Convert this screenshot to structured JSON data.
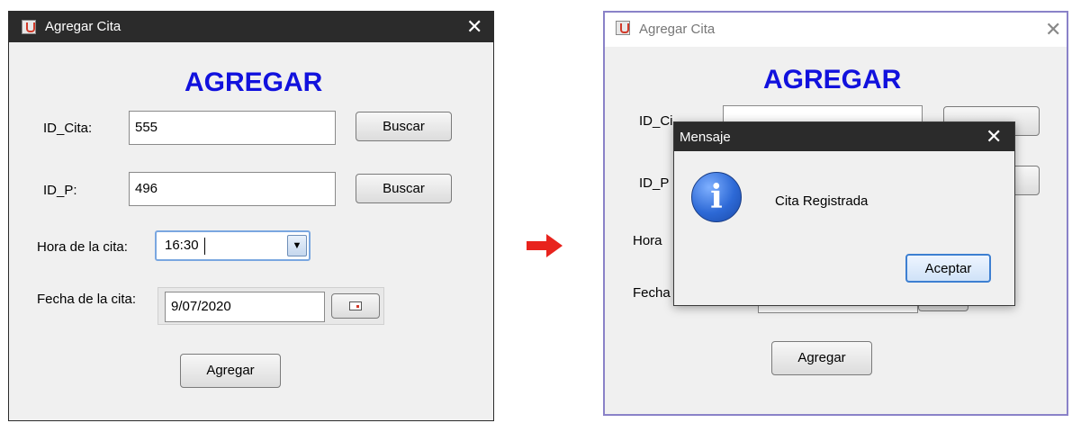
{
  "left_window": {
    "title": "Agregar Cita",
    "close_glyph": "✕",
    "heading": "AGREGAR",
    "id_cita_label": "ID_Cita:",
    "id_cita_value": "555",
    "buscar_label": "Buscar",
    "id_p_label": "ID_P:",
    "id_p_value": "496",
    "hora_label": "Hora de la cita:",
    "hora_value": "16:30",
    "fecha_label": "Fecha de la cita:",
    "fecha_value": "9/07/2020",
    "agregar_button": "Agregar"
  },
  "right_window": {
    "title": "Agregar Cita",
    "close_glyph": "✕",
    "heading": "AGREGAR",
    "id_cita_label_partial": "ID_Ci",
    "id_p_label_partial": "ID_P",
    "hora_label_partial": "Hora",
    "fecha_label_partial": "Fecha",
    "agregar_button": "Agregar"
  },
  "dialog": {
    "title": "Mensaje",
    "close_glyph": "✕",
    "message": "Cita Registrada",
    "ok_button": "Aceptar",
    "icon": "info-icon"
  },
  "colors": {
    "heading": "#1111dd",
    "titlebar_dark": "#2b2b2b",
    "arrow": "#e8231d",
    "right_border": "#8a82c8"
  }
}
